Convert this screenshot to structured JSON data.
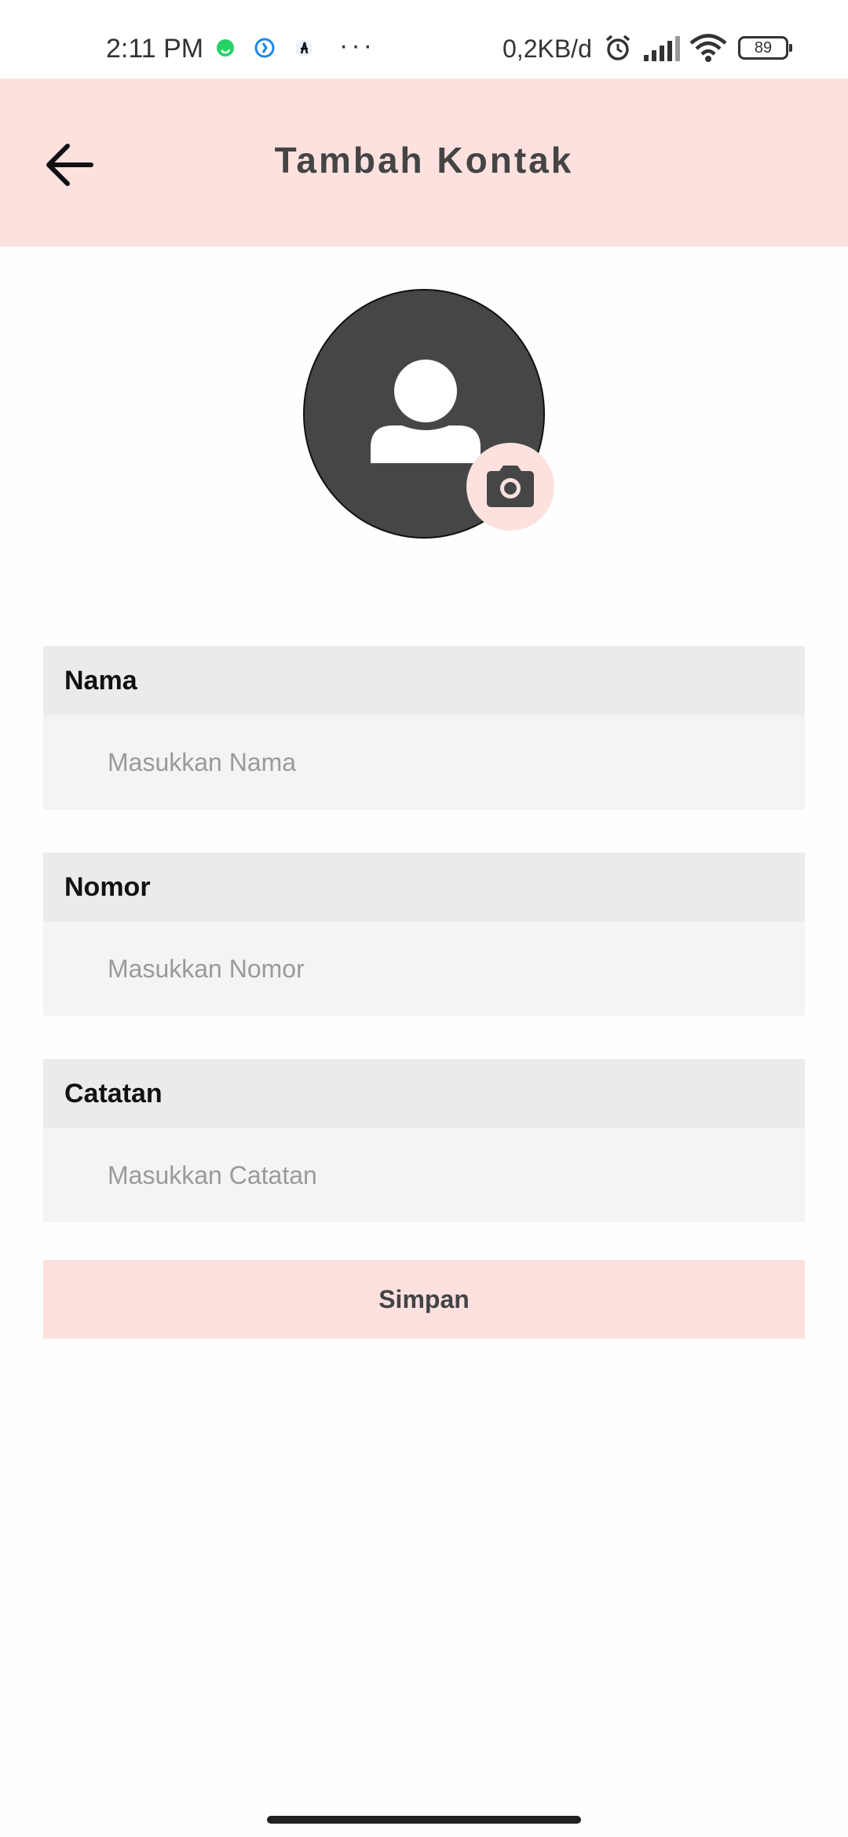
{
  "status_bar": {
    "time": "2:11 PM",
    "network_speed": "0,2KB/d",
    "battery_level": "89",
    "more_indicator": "···",
    "icons": [
      "whatsapp-icon",
      "vpn-app-icon",
      "app-notification-icon",
      "alarm-icon",
      "signal-icon",
      "wifi-icon",
      "battery-icon"
    ]
  },
  "app_bar": {
    "title": "Tambah Kontak",
    "back_icon": "arrow-left-icon",
    "background": "#fde1df"
  },
  "avatar": {
    "placeholder_icon": "person-icon",
    "camera_icon": "camera-icon"
  },
  "form": {
    "name": {
      "label": "Nama",
      "placeholder": "Masukkan Nama",
      "value": ""
    },
    "number": {
      "label": "Nomor",
      "placeholder": "Masukkan Nomor",
      "value": ""
    },
    "notes": {
      "label": "Catatan",
      "placeholder": "Masukkan Catatan",
      "value": ""
    }
  },
  "save_button": {
    "label": "Simpan"
  },
  "colors": {
    "accent": "#fde1df",
    "label_bar": "#ebebeb",
    "input_bg": "#f4f4f4",
    "avatar_bg": "#464646"
  }
}
